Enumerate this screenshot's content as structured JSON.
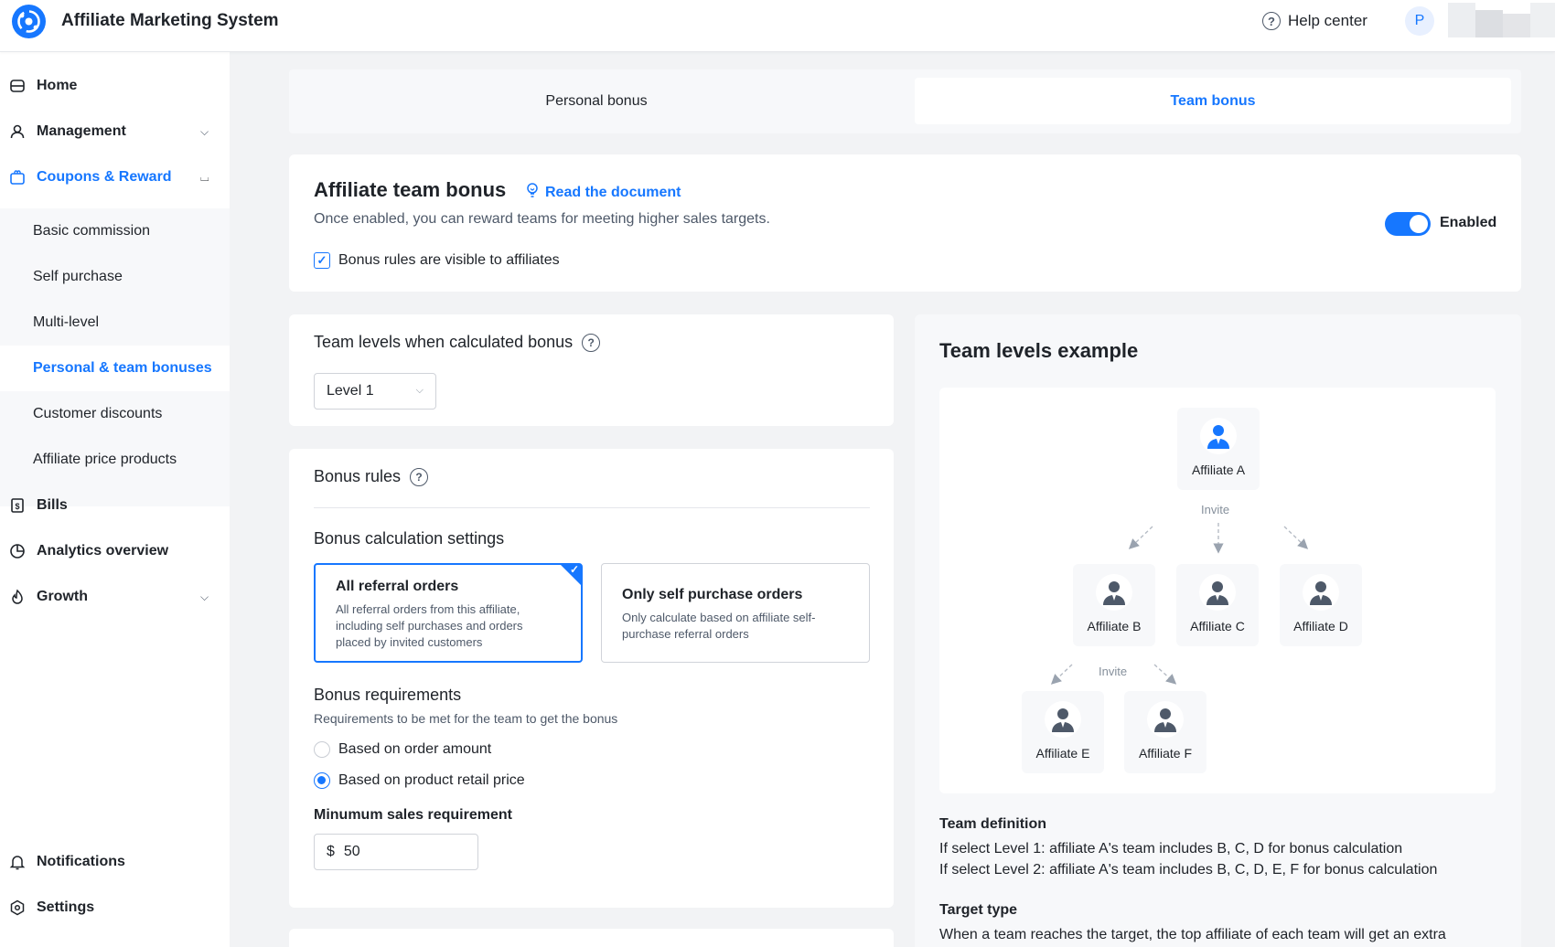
{
  "app": {
    "title": "Affiliate Marketing System"
  },
  "header": {
    "help_label": "Help center",
    "avatar_initial": "P"
  },
  "sidebar": {
    "home": "Home",
    "management": "Management",
    "coupons": "Coupons & Reward",
    "sub_items": [
      "Basic commission",
      "Self purchase",
      "Multi-level",
      "Personal & team bonuses",
      "Customer discounts",
      "Affiliate price products"
    ],
    "bills": "Bills",
    "analytics": "Analytics overview",
    "growth": "Growth",
    "notifications": "Notifications",
    "settings": "Settings"
  },
  "tabs": {
    "personal": "Personal bonus",
    "team": "Team bonus",
    "active": "Team bonus"
  },
  "team_bonus": {
    "title": "Affiliate team bonus",
    "doc_link": "Read the document",
    "description": "Once enabled, you can reward teams for meeting higher sales targets.",
    "visible_checkbox": "Bonus rules are visible to affiliates",
    "visible_checked": true,
    "enabled": true,
    "enabled_label": "Enabled"
  },
  "levels": {
    "title": "Team levels when calculated bonus",
    "selected": "Level 1"
  },
  "rules": {
    "title": "Bonus rules",
    "calc_title": "Bonus calculation settings",
    "option1_title": "All referral orders",
    "option1_desc": "All referral orders from this affiliate, including self purchases and orders placed by invited customers",
    "option2_title": "Only self purchase orders",
    "option2_desc": "Only calculate based on affiliate self-purchase referral orders",
    "selected_option": "All referral orders",
    "req_title": "Bonus requirements",
    "req_desc": "Requirements to be met for the team to get the bonus",
    "radio1": "Based on order amount",
    "radio2": "Based on product retail price",
    "selected_radio": "Based on product retail price",
    "min_label": "Minumum sales requirement",
    "currency": "$",
    "min_value": "50"
  },
  "example": {
    "title": "Team levels example",
    "nodes": {
      "a": "Affiliate A",
      "b": "Affiliate B",
      "c": "Affiliate C",
      "d": "Affiliate D",
      "e": "Affiliate E",
      "f": "Affiliate F"
    },
    "invite": "Invite",
    "team_def_title": "Team definition",
    "team_def_line1": "If select Level 1: affiliate A's team includes B, C, D for bonus calculation",
    "team_def_line2": "If select Level 2: affiliate A's team includes B, C, D, E, F for bonus calculation",
    "target_title": "Target type",
    "target_line1": "When a team reaches the target, the top affiliate of each team will get an extra"
  },
  "colors": {
    "accent": "#1677ff",
    "node_icon_active": "#1677ff",
    "node_icon": "#4e5969"
  },
  "icons": [
    "logo-icon",
    "help-icon",
    "home-icon",
    "user-icon",
    "gift-icon",
    "bill-icon",
    "chart-icon",
    "growth-icon",
    "bell-icon",
    "settings-icon",
    "bulb-icon",
    "question-icon",
    "person-icon"
  ]
}
